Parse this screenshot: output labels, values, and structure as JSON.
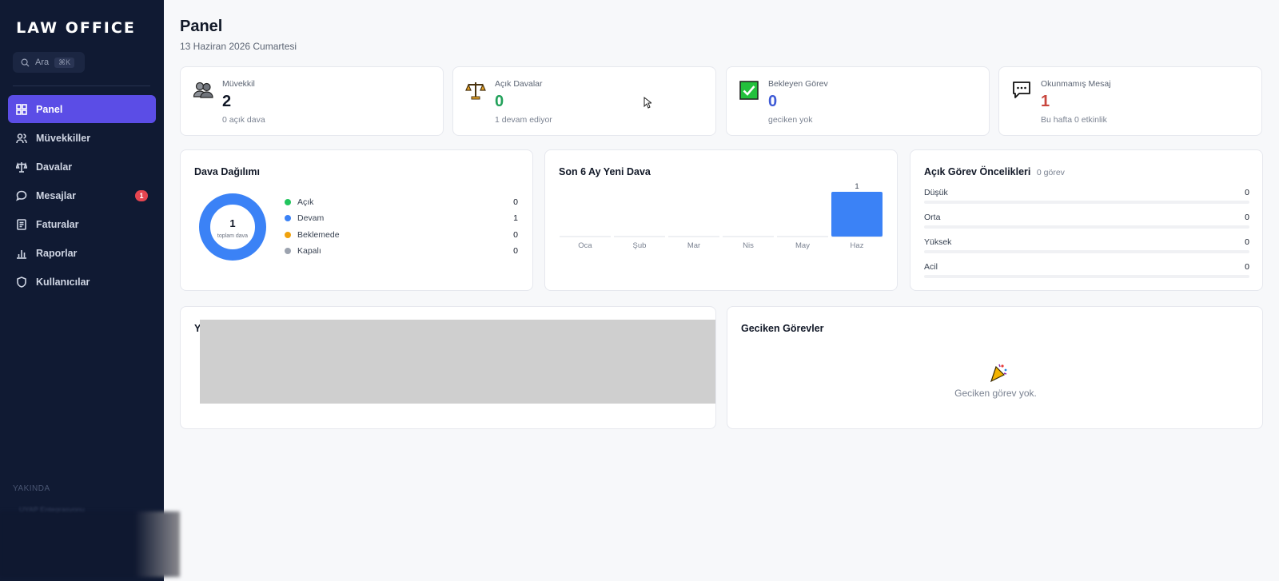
{
  "app": {
    "brand": "LAW OFFICE"
  },
  "search": {
    "placeholder": "Ara",
    "shortcut": "⌘K"
  },
  "sidebar": {
    "items": [
      {
        "label": "Panel",
        "icon": "grid-icon",
        "active": true
      },
      {
        "label": "Müvekkiller",
        "icon": "users-icon"
      },
      {
        "label": "Davalar",
        "icon": "scale-icon"
      },
      {
        "label": "Mesajlar",
        "icon": "chat-icon",
        "badge": "1"
      },
      {
        "label": "Faturalar",
        "icon": "invoice-icon"
      },
      {
        "label": "Raporlar",
        "icon": "bar-chart-icon"
      },
      {
        "label": "Kullanıcılar",
        "icon": "shield-icon"
      }
    ],
    "section_label": "YAKINDA",
    "soon_item": "UYAP Entegrasyonu"
  },
  "page": {
    "title": "Panel",
    "date": "13 Haziran 2026 Cumartesi"
  },
  "stats": [
    {
      "label": "Müvekkil",
      "value": "2",
      "sub": "0 açık dava",
      "color": "#111827",
      "icon": "people-icon"
    },
    {
      "label": "Açık Davalar",
      "value": "0",
      "sub": "1 devam ediyor",
      "color": "#22a15a",
      "icon": "scales-icon"
    },
    {
      "label": "Bekleyen Görev",
      "value": "0",
      "sub": "geciken yok",
      "color": "#3f5bd6",
      "icon": "check-box-icon"
    },
    {
      "label": "Okunmamış Mesaj",
      "value": "1",
      "sub": "Bu hafta 0 etkinlik",
      "color": "#c8463d",
      "icon": "speech-bubble-icon"
    }
  ],
  "case_distribution": {
    "title": "Dava Dağılımı",
    "total": "1",
    "total_label": "toplam dava",
    "items": [
      {
        "label": "Açık",
        "value": "0",
        "color": "#22c55e"
      },
      {
        "label": "Devam",
        "value": "1",
        "color": "#3b82f6"
      },
      {
        "label": "Beklemede",
        "value": "0",
        "color": "#f0a20d"
      },
      {
        "label": "Kapalı",
        "value": "0",
        "color": "#9ca3af"
      }
    ]
  },
  "new_cases": {
    "title": "Son 6 Ay Yeni Dava",
    "bar_color": "#3b82f6"
  },
  "priorities": {
    "title": "Açık Görev Öncelikleri",
    "count_label": "0 görev",
    "items": [
      {
        "label": "Düşük",
        "value": "0"
      },
      {
        "label": "Orta",
        "value": "0"
      },
      {
        "label": "Yüksek",
        "value": "0"
      },
      {
        "label": "Acil",
        "value": "0"
      }
    ]
  },
  "recent": {
    "title_visible": "Y"
  },
  "overdue": {
    "title": "Geciken Görevler",
    "empty_text": "Geciken görev yok."
  },
  "chart_data": {
    "type": "bar",
    "title": "Son 6 Ay Yeni Dava",
    "categories": [
      "Oca",
      "Şub",
      "Mar",
      "Nis",
      "May",
      "Haz"
    ],
    "values": [
      0,
      0,
      0,
      0,
      0,
      1
    ],
    "data_labels": [
      "",
      "",
      "",
      "",
      "",
      "1"
    ],
    "xlabel": "",
    "ylabel": "",
    "ylim": [
      0,
      1
    ],
    "grid": false
  }
}
